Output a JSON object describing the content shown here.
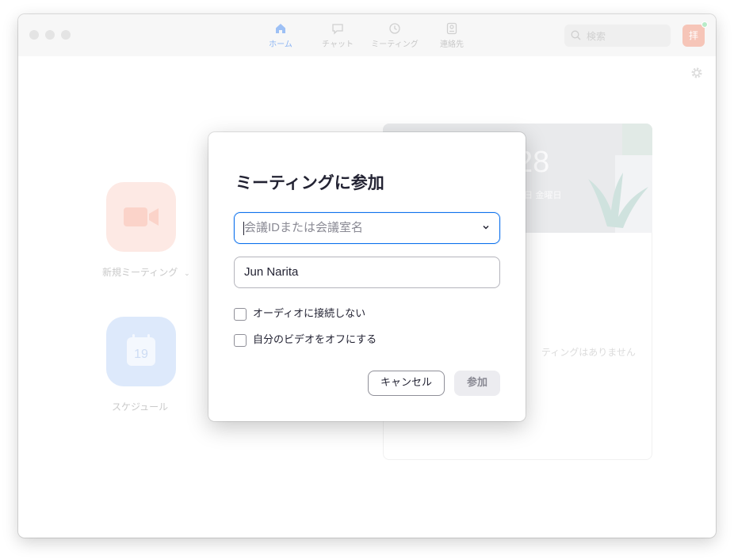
{
  "app": {
    "nav_tabs": [
      {
        "label": "ホーム",
        "icon": "home-icon",
        "active": true
      },
      {
        "label": "チャット",
        "icon": "chat-icon",
        "active": false
      },
      {
        "label": "ミーティング",
        "icon": "clock-icon",
        "active": false
      },
      {
        "label": "連絡先",
        "icon": "contacts-icon",
        "active": false
      }
    ],
    "search_placeholder": "検索",
    "avatar_initial": "拝",
    "tiles": {
      "new_meeting_label": "新規ミーティング",
      "schedule_label": "スケジュール",
      "calendar_day": "19"
    },
    "panel": {
      "time": "28",
      "date": "日 金曜日",
      "empty_text": "ティングはありません"
    },
    "colors": {
      "accent": "#0e72ed",
      "new_meeting_tile": "#fde9e4",
      "schedule_tile": "#dde9fb"
    }
  },
  "dialog": {
    "title": "ミーティングに参加",
    "meeting_id_placeholder": "会議IDまたは会議室名",
    "name_value": "Jun Narita",
    "options": [
      {
        "label": "オーディオに接続しない",
        "checked": false
      },
      {
        "label": "自分のビデオをオフにする",
        "checked": false
      }
    ],
    "cancel_label": "キャンセル",
    "join_label": "参加"
  }
}
